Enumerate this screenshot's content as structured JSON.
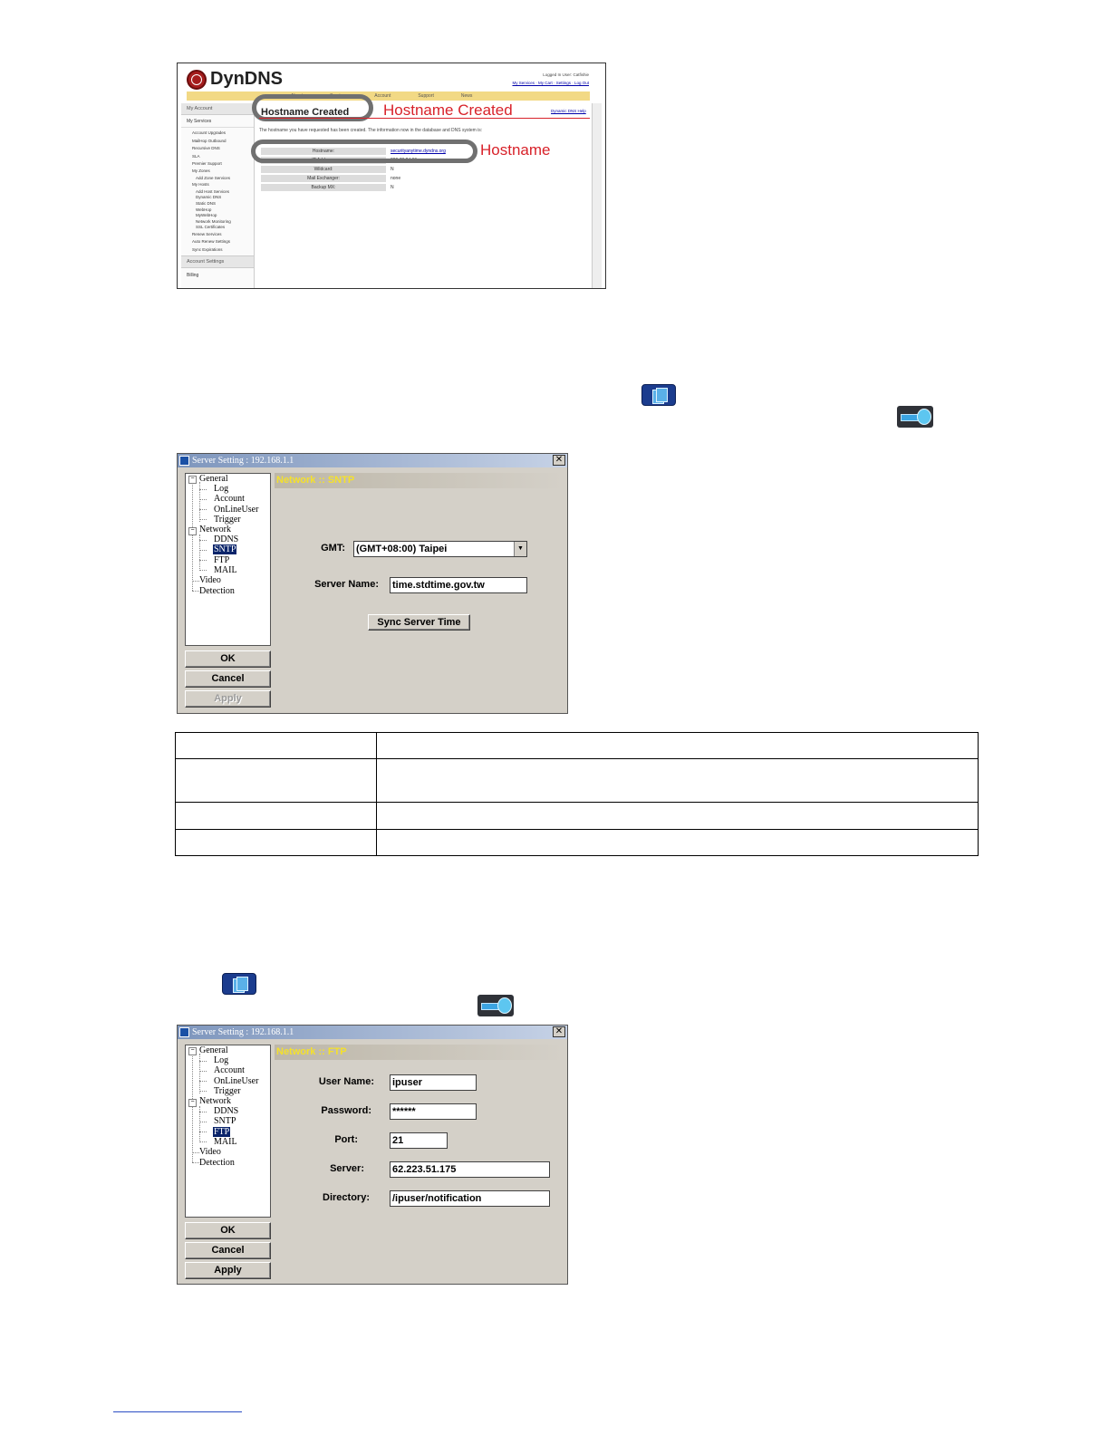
{
  "dyndns": {
    "logo": "DynDNS",
    "logged_in_line": "Logged In User: Catfishie",
    "top_links": "My Services · My Cart · Settings · Log Out",
    "nav": [
      "About",
      "Services",
      "Account",
      "Support",
      "News"
    ],
    "sidebar": {
      "my_account": "My Account",
      "my_services": "My Services",
      "items": [
        "Account Upgrades",
        "MailHop Outbound",
        "Recursive DNS",
        "SLA",
        "Premier Support",
        "My Zones"
      ],
      "zone_sub": [
        "Add Zone Services"
      ],
      "my_hosts": "My Hosts",
      "host_sub": [
        "Add Host Services",
        "Dynamic DNS",
        "Static DNS",
        "WebHop",
        "MyWebHop",
        "Network Monitoring",
        "SSL Certificates"
      ],
      "items2": [
        "Renew Services",
        "Auto Renew Settings",
        "Sync Expirations"
      ],
      "account_settings": "Account Settings",
      "billing": "Billing"
    },
    "heading": "Hostname Created",
    "heading_callout": "Hostname Created",
    "right_link": "Dynamic DNS Help",
    "description": "The hostname you have requested has been created. The information now in the database and DNS system is:",
    "details": [
      {
        "key": "Hostname:",
        "value": "securityanytime.dyndns.org",
        "link": true
      },
      {
        "key": "IP Address:",
        "value": "220.73.24.69",
        "link": false
      },
      {
        "key": "Wildcard:",
        "value": "N",
        "link": false
      },
      {
        "key": "Mail Exchanger:",
        "value": "none",
        "link": false
      },
      {
        "key": "Backup MX:",
        "value": "N",
        "link": false
      }
    ],
    "hostname_callout": "Hostname"
  },
  "dialogs": [
    {
      "title": "Server Setting : 192.168.1.1",
      "tree": {
        "general": "General",
        "log": "Log",
        "account": "Account",
        "online_user": "OnLineUser",
        "trigger": "Trigger",
        "network": "Network",
        "ddns": "DDNS",
        "sntp": "SNTP",
        "ftp": "FTP",
        "mail": "MAIL",
        "video": "Video",
        "detection": "Detection",
        "selected": "SNTP"
      },
      "buttons": {
        "ok": "OK",
        "cancel": "Cancel",
        "apply": "Apply"
      },
      "panel_title": "Network :: SNTP",
      "gmt_label": "GMT:",
      "gmt_value": "(GMT+08:00) Taipei",
      "server_label": "Server Name:",
      "server_value": "time.stdtime.gov.tw",
      "sync_button": "Sync Server Time"
    },
    {
      "title": "Server Setting : 192.168.1.1",
      "tree": {
        "general": "General",
        "log": "Log",
        "account": "Account",
        "online_user": "OnLineUser",
        "trigger": "Trigger",
        "network": "Network",
        "ddns": "DDNS",
        "sntp": "SNTP",
        "ftp": "FTP",
        "mail": "MAIL",
        "video": "Video",
        "detection": "Detection",
        "selected": "FTP"
      },
      "buttons": {
        "ok": "OK",
        "cancel": "Cancel",
        "apply": "Apply"
      },
      "panel_title": "Network :: FTP",
      "fields": [
        {
          "label": "User Name:",
          "value": "ipuser"
        },
        {
          "label": "Password:",
          "value": "******"
        },
        {
          "label": "Port:",
          "value": "21"
        },
        {
          "label": "Server:",
          "value": "62.223.51.175"
        },
        {
          "label": "Directory:",
          "value": "/ipuser/notification"
        }
      ]
    }
  ],
  "icons": [
    "server-settings-icon",
    "network-icon",
    "server-settings-icon",
    "network-icon"
  ]
}
